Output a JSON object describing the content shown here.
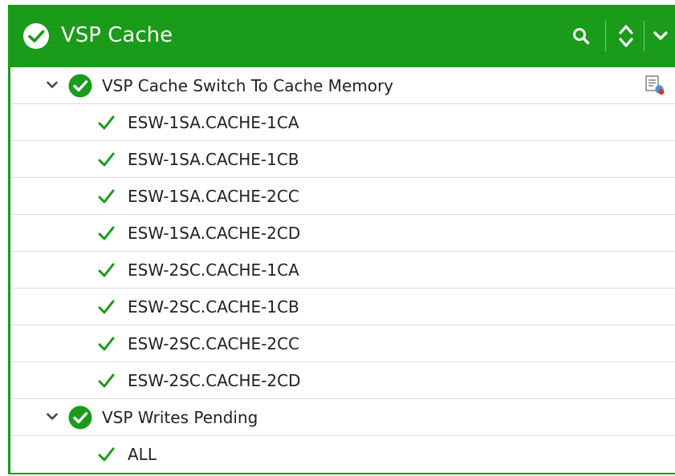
{
  "header": {
    "title": "VSP Cache",
    "status_icon": "check-circle-icon",
    "actions": [
      "search-icon",
      "sort-icon",
      "chevron-down-icon"
    ]
  },
  "tree": {
    "groups": [
      {
        "label": "VSP Cache Switch To Cache Memory",
        "status_icon": "check-circle-icon",
        "action_icon": "report-alert-icon",
        "items": [
          {
            "label": "ESW-1SA.CACHE-1CA"
          },
          {
            "label": "ESW-1SA.CACHE-1CB"
          },
          {
            "label": "ESW-1SA.CACHE-2CC"
          },
          {
            "label": "ESW-1SA.CACHE-2CD"
          },
          {
            "label": "ESW-2SC.CACHE-1CA"
          },
          {
            "label": "ESW-2SC.CACHE-1CB"
          },
          {
            "label": "ESW-2SC.CACHE-2CC"
          },
          {
            "label": "ESW-2SC.CACHE-2CD"
          }
        ]
      },
      {
        "label": "VSP Writes Pending",
        "status_icon": "check-circle-icon",
        "items": [
          {
            "label": "ALL"
          }
        ]
      }
    ]
  },
  "colors": {
    "header_bg": "#1a9b1a",
    "status_ok": "#1a9b1a",
    "text": "#222222",
    "row_border": "#dcdcdc"
  }
}
